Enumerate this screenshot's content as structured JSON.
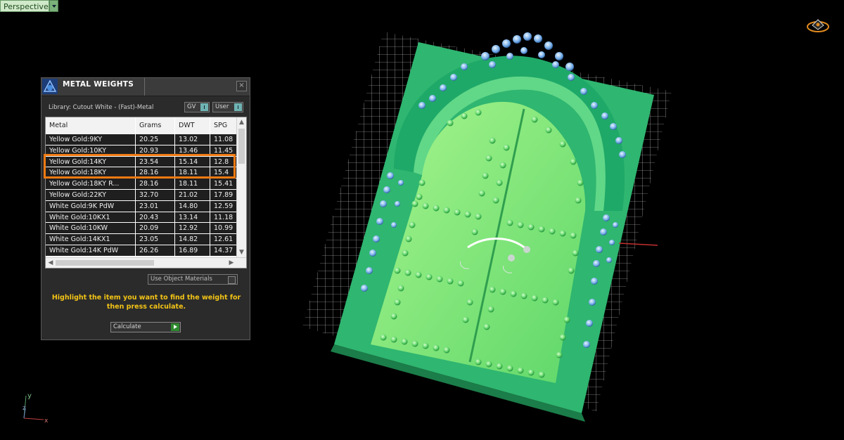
{
  "viewport": {
    "label": "Perspective"
  },
  "panel": {
    "title": "METAL WEIGHTS",
    "close": "×",
    "library": "Library: Cutout White - (Fast)-Metal",
    "gv": "GV",
    "user": "User",
    "columns": [
      "Metal",
      "Grams",
      "DWT",
      "SPG"
    ],
    "rows": [
      [
        "Yellow Gold:9KY",
        "20.25",
        "13.02",
        "11.08"
      ],
      [
        "Yellow Gold:10KY",
        "20.93",
        "13.46",
        "11.45"
      ],
      [
        "Yellow Gold:14KY",
        "23.54",
        "15.14",
        "12.8"
      ],
      [
        "Yellow Gold:18KY",
        "28.16",
        "18.11",
        "15.4"
      ],
      [
        "Yellow Gold:18KY R...",
        "28.16",
        "18.11",
        "15.41"
      ],
      [
        "Yellow Gold:22KY",
        "32.70",
        "21.02",
        "17.89"
      ],
      [
        "White Gold:9K PdW",
        "23.01",
        "14.80",
        "12.59"
      ],
      [
        "White Gold:10KX1",
        "20.43",
        "13.14",
        "11.18"
      ],
      [
        "White Gold:10KW",
        "20.09",
        "12.92",
        "10.99"
      ],
      [
        "White Gold:14KX1",
        "23.05",
        "14.82",
        "12.61"
      ],
      [
        "White Gold:14K PdW",
        "26.26",
        "16.89",
        "14.37"
      ]
    ],
    "use_object_materials": "Use Object Materials",
    "hint": "Highlight the item you want to find the weight for then press calculate.",
    "calculate": "Calculate"
  },
  "axis": {
    "y": "y",
    "z": "z",
    "x": "x"
  },
  "colors": {
    "highlight": "#f07a12",
    "hint": "#f2c316",
    "model_green": "#3ec97f",
    "door_green": "#8df07a"
  }
}
